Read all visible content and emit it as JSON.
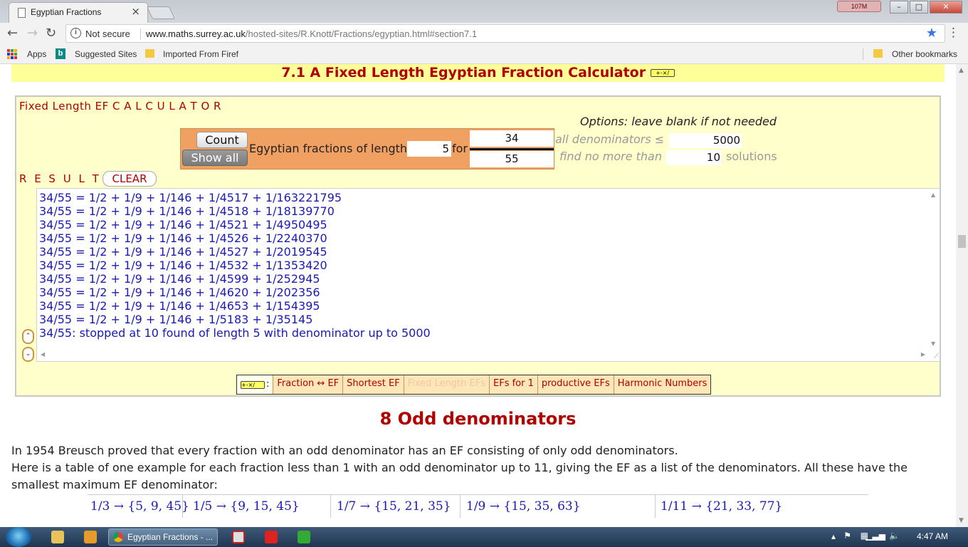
{
  "browser": {
    "tab_title": "Egyptian Fractions",
    "tab_close": "×",
    "memory_badge": "107M",
    "not_secure": "Not secure",
    "url_host": "www.maths.surrey.ac.uk",
    "url_path": "/hosted-sites/R.Knott/Fractions/egyptian.html#section7.1",
    "bookmarks": {
      "apps": "Apps",
      "suggested": "Suggested Sites",
      "imported": "Imported From Firef",
      "other": "Other bookmarks"
    }
  },
  "section71": {
    "heading": "7.1 A Fixed Length Egyptian Fraction Calculator",
    "calc_icon": "+-×/"
  },
  "calculator": {
    "title": "Fixed Length EF C A L C U L A T O R",
    "options_label": "Options: leave blank if not needed",
    "count_button": "Count",
    "showall_button": "Show all",
    "ef_label": "Egyptian fractions of length",
    "length_value": "5",
    "for_label": "for",
    "numerator": "34",
    "denominator": "55",
    "all_denominators_label": "all denominators ≤",
    "max_denominator": "5000",
    "find_no_more_label": "find no more than",
    "max_solutions": "10",
    "solutions_label": "solutions",
    "results_label": "R E S U L T S",
    "clear_button": "CLEAR",
    "results": [
      "34/55 = 1/2 + 1/9 + 1/146 + 1/4517 + 1/163221795",
      "34/55 = 1/2 + 1/9 + 1/146 + 1/4518 + 1/18139770",
      "34/55 = 1/2 + 1/9 + 1/146 + 1/4521 + 1/4950495",
      "34/55 = 1/2 + 1/9 + 1/146 + 1/4526 + 1/2240370",
      "34/55 = 1/2 + 1/9 + 1/146 + 1/4527 + 1/2019545",
      "34/55 = 1/2 + 1/9 + 1/146 + 1/4532 + 1/1353420",
      "34/55 = 1/2 + 1/9 + 1/146 + 1/4599 + 1/252945",
      "34/55 = 1/2 + 1/9 + 1/146 + 1/4620 + 1/202356",
      "34/55 = 1/2 + 1/9 + 1/146 + 1/4653 + 1/154395",
      "34/55 = 1/2 + 1/9 + 1/146 + 1/5183 + 1/35145",
      "34/55: stopped at 10 found of length 5 with denominator up to 5000"
    ],
    "spin_up": "⌃",
    "spin_down": "⌄"
  },
  "linkbar": {
    "icon_suffix": ":",
    "items": [
      {
        "label": "Fraction ↔ EF",
        "disabled": false
      },
      {
        "label": "Shortest EF",
        "disabled": false
      },
      {
        "label": "Fixed Length EFs",
        "disabled": true
      },
      {
        "label": "EFs for 1",
        "disabled": false
      },
      {
        "label": "productive EFs",
        "disabled": false
      },
      {
        "label": "Harmonic Numbers",
        "disabled": false
      }
    ]
  },
  "section8": {
    "heading": "8 Odd denominators",
    "para1": "In 1954 Breusch proved that every fraction with an odd denominator has an EF consisting of only odd denominators.",
    "para2a": "Here is a table of one example for each fraction less than 1 with an odd denominator up to 11, giving the EF as a list of the denominators. All these have the",
    "para2b": "smallest maximum EF denominator:",
    "table": [
      "1/3 → {5, 9, 45}",
      "1/5 → {9, 15, 45}",
      "1/7 → {15, 21, 35}",
      "1/9 → {15, 35, 63}",
      "1/11 → {21, 33, 77}"
    ]
  },
  "taskbar": {
    "task_label": "Egyptian Fractions - ...",
    "clock": "4:47 AM"
  },
  "colors": {
    "heading_red": "#b00000",
    "highlight_yellow": "#ffff99",
    "calc_bg": "#ffffcc",
    "orange_panel": "#f0a061",
    "result_blue": "#1a1ab4"
  }
}
